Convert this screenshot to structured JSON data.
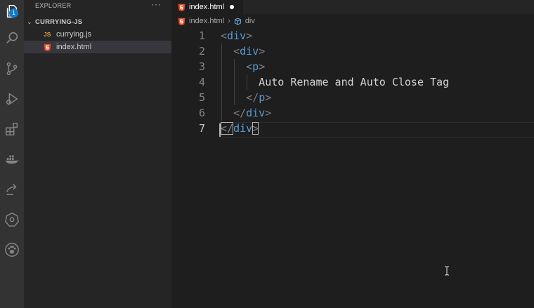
{
  "activity_bar": {
    "explorer_badge": "1",
    "icons": [
      "files-icon",
      "search-icon",
      "source-control-icon",
      "run-debug-icon",
      "extensions-icon",
      "docker-icon",
      "remote-icon",
      "kubernetes-icon",
      "paw-icon"
    ]
  },
  "sidebar": {
    "header": "EXPLORER",
    "more_label": "···",
    "folder": "CURRYING-JS",
    "files": [
      {
        "name": "currying.js",
        "icon": "JS",
        "active": false
      },
      {
        "name": "index.html",
        "icon": "html-icon",
        "active": true
      }
    ]
  },
  "tab": {
    "label": "index.html",
    "modified": true
  },
  "breadcrumb": {
    "file": "index.html",
    "separator": "›",
    "symbol": "div"
  },
  "editor": {
    "lines": [
      {
        "num": "1",
        "tokens": [
          [
            "bracket",
            "<"
          ],
          [
            "tag",
            "div"
          ],
          [
            "bracket",
            ">"
          ]
        ]
      },
      {
        "num": "2",
        "tokens": [
          [
            "txt",
            "  "
          ],
          [
            "bracket",
            "<"
          ],
          [
            "tag",
            "div"
          ],
          [
            "bracket",
            ">"
          ]
        ]
      },
      {
        "num": "3",
        "tokens": [
          [
            "txt",
            "    "
          ],
          [
            "bracket",
            "<"
          ],
          [
            "tag",
            "p"
          ],
          [
            "bracket",
            ">"
          ]
        ]
      },
      {
        "num": "4",
        "tokens": [
          [
            "txt",
            "      Auto Rename and Auto Close Tag"
          ]
        ]
      },
      {
        "num": "5",
        "tokens": [
          [
            "txt",
            "    "
          ],
          [
            "bracket",
            "</"
          ],
          [
            "tag",
            "p"
          ],
          [
            "bracket",
            ">"
          ]
        ]
      },
      {
        "num": "6",
        "tokens": [
          [
            "txt",
            "  "
          ],
          [
            "bracket",
            "</"
          ],
          [
            "tag",
            "div"
          ],
          [
            "bracket",
            ">"
          ]
        ]
      },
      {
        "num": "7",
        "tokens": [
          [
            "bracket",
            "</"
          ],
          [
            "tag",
            "div"
          ],
          [
            "bracket",
            ">"
          ]
        ]
      }
    ],
    "current_line": 7
  },
  "colors": {
    "accent": "#0e7ad3",
    "tag": "#569cd6",
    "html_orange": "#e44d26",
    "js_yellow": "#e5a54d"
  }
}
